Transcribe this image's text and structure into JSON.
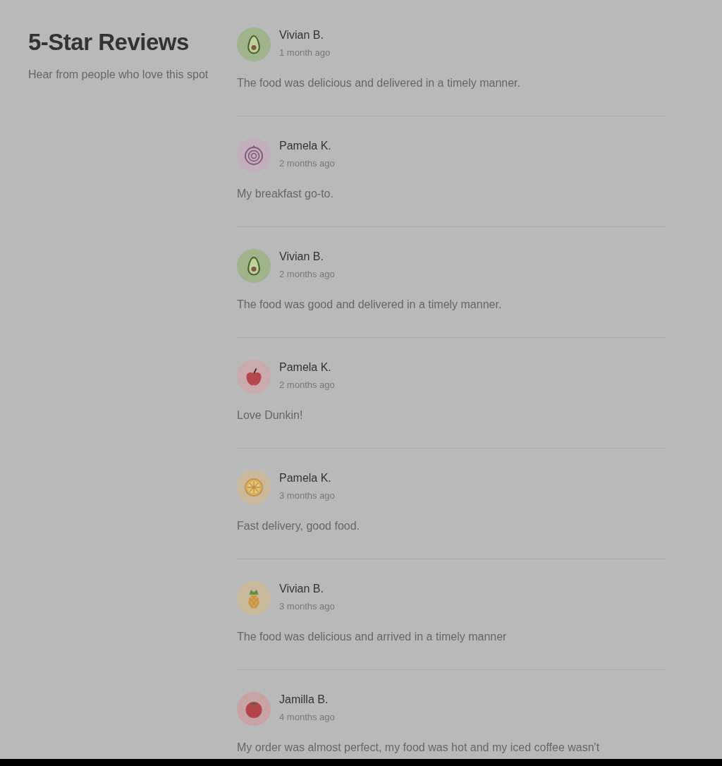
{
  "heading": {
    "title": "5-Star Reviews",
    "subtitle": "Hear from people who love this spot"
  },
  "reviews": [
    {
      "name": "Vivian B.",
      "time": "1 month ago",
      "text": "The food was delicious and delivered in a timely manner.",
      "avatar": {
        "kind": "avocado"
      }
    },
    {
      "name": "Pamela K.",
      "time": "2 months ago",
      "text": "My breakfast go-to.",
      "avatar": {
        "kind": "onion"
      }
    },
    {
      "name": "Vivian B.",
      "time": "2 months ago",
      "text": "The food was good and delivered in a timely manner.",
      "avatar": {
        "kind": "avocado"
      }
    },
    {
      "name": "Pamela K.",
      "time": "2 months ago",
      "text": "Love Dunkin!",
      "avatar": {
        "kind": "apple"
      }
    },
    {
      "name": "Pamela K.",
      "time": "3 months ago",
      "text": "Fast delivery, good food.",
      "avatar": {
        "kind": "citrus"
      }
    },
    {
      "name": "Vivian B.",
      "time": "3 months ago",
      "text": "The food was delicious and arrived in a timely manner",
      "avatar": {
        "kind": "pineapple"
      }
    },
    {
      "name": "Jamilla B.",
      "time": "4 months ago",
      "text": "My order was almost perfect, my food was hot and my iced coffee wasn't",
      "avatar": {
        "kind": "tomato"
      }
    }
  ]
}
